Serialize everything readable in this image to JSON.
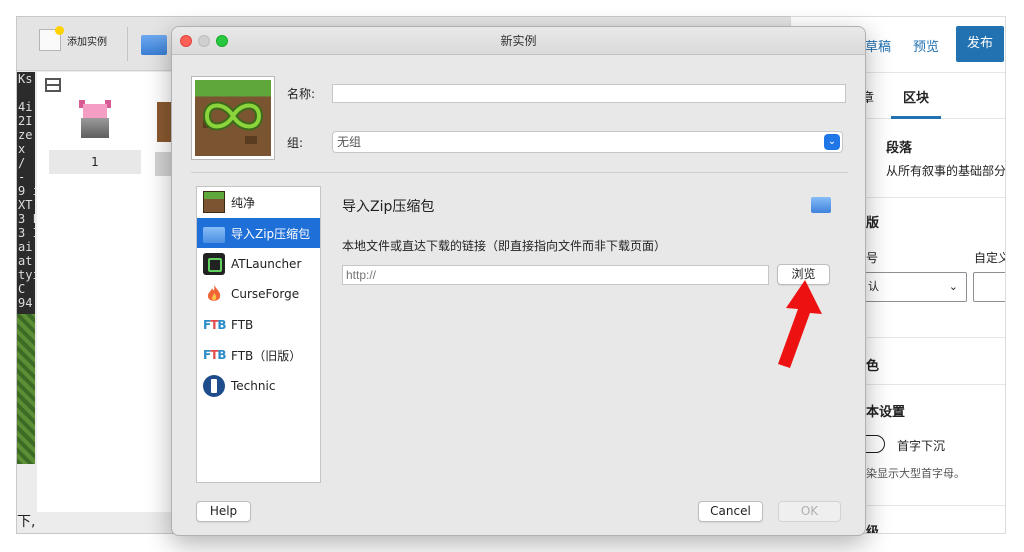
{
  "back_window": {
    "toolbar": {
      "add_instance_label": "添加实例"
    },
    "side_text": "Ks\n\n4i\n2I\nze\nx\n/\n-\n9 i\nXT\n3 F\n3 I\nai\nat\ntyi\nC\n94\n\nhil\nes",
    "instance": {
      "label": "1"
    },
    "bottom_char": "下,"
  },
  "wordpress": {
    "draft_label": "草稿",
    "preview_label": "预览",
    "publish_label": "发布",
    "tab_document": "章",
    "tab_block": "区块",
    "paragraph_title": "段落",
    "paragraph_desc": "从所有叙事的基础部分",
    "section_typography": "版",
    "size_label": "号",
    "custom_label": "自定义",
    "size_select_value": "认",
    "section_color": "色",
    "section_text_settings": "本设置",
    "dropcap_label": "首字下沉",
    "dropcap_help": "染显示大型首字母。",
    "section_advanced": "级"
  },
  "dialog": {
    "title": "新实例",
    "name_label": "名称:",
    "name_value": "",
    "group_label": "组:",
    "group_value": "无组",
    "sources": [
      {
        "label": "纯净",
        "icon": "grass-block-icon"
      },
      {
        "label": "导入Zip压缩包",
        "icon": "folder-icon"
      },
      {
        "label": "ATLauncher",
        "icon": "atlauncher-icon"
      },
      {
        "label": "CurseForge",
        "icon": "curseforge-flame-icon"
      },
      {
        "label": "FTB",
        "icon": "ftb-icon"
      },
      {
        "label": "FTB（旧版）",
        "icon": "ftb-legacy-icon"
      },
      {
        "label": "Technic",
        "icon": "technic-icon"
      }
    ],
    "selected_source_index": 1,
    "import": {
      "title": "导入Zip压缩包",
      "description": "本地文件或直达下载的链接（即直接指向文件而非下载页面）",
      "url_placeholder": "http://",
      "browse_label": "浏览"
    },
    "help_label": "Help",
    "cancel_label": "Cancel",
    "ok_label": "OK"
  },
  "colors": {
    "accent": "#1f6fd8",
    "wp_blue": "#2271b1",
    "arrow_red": "#ee1111"
  }
}
